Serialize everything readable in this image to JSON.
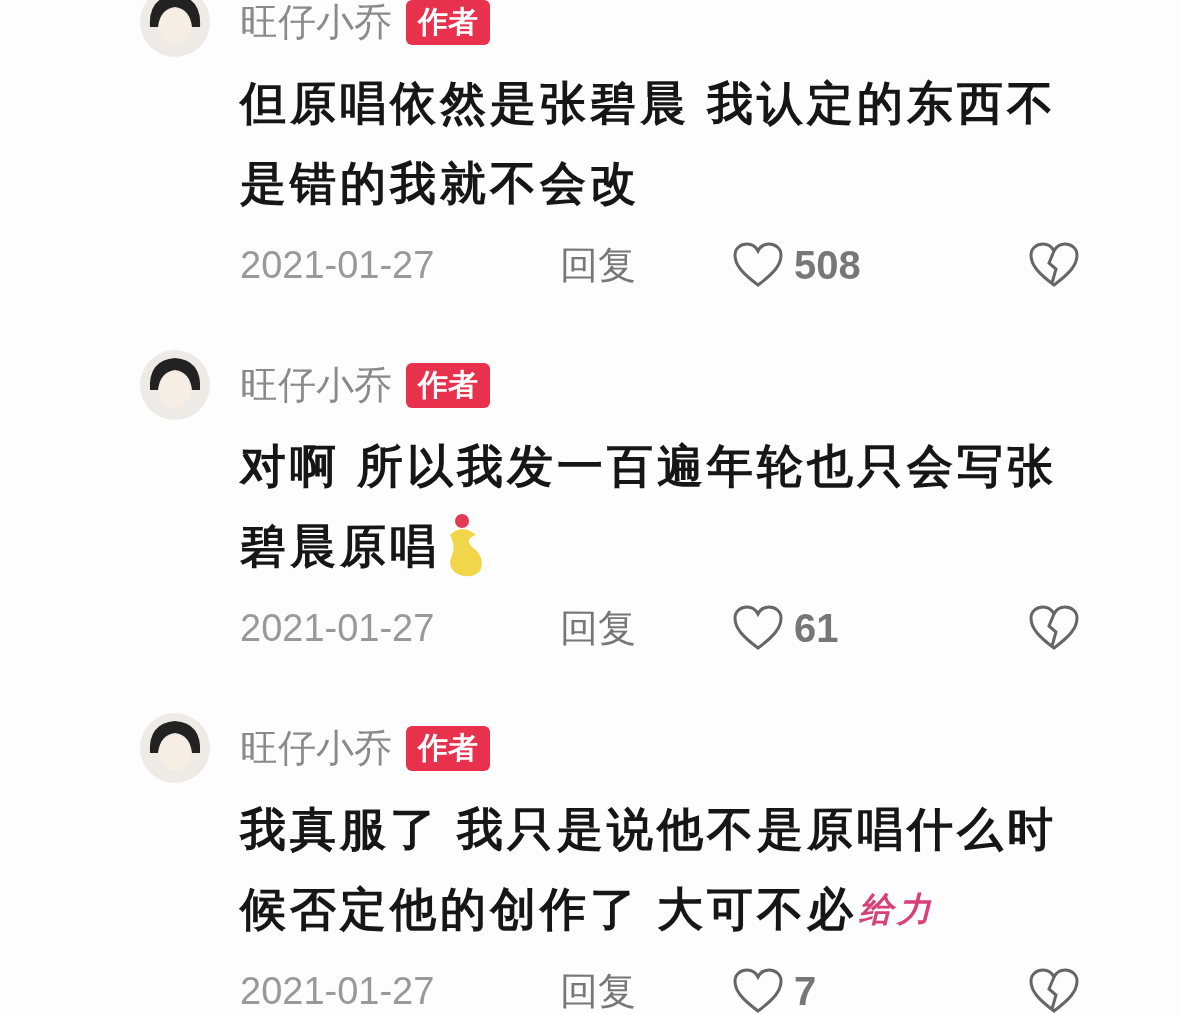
{
  "comments": [
    {
      "author": "旺仔小乔",
      "badge": "作者",
      "lines": [
        "但原唱依然是张碧晨 我认定的东西不",
        "是错的我就不会改"
      ],
      "date": "2021-01-27",
      "reply": "回复",
      "likes": "508"
    },
    {
      "author": "旺仔小乔",
      "badge": "作者",
      "lines": [
        "对啊 所以我发一百遍年轮也只会写张",
        "碧晨原唱"
      ],
      "sticker": {
        "kind": "heart-hands"
      },
      "date": "2021-01-27",
      "reply": "回复",
      "likes": "61"
    },
    {
      "author": "旺仔小乔",
      "badge": "作者",
      "lines": [
        "我真服了 我只是说他不是原唱什么时",
        "候否定他的创作了 大可不必"
      ],
      "sticker": {
        "kind": "text",
        "text": "给力"
      },
      "date": "2021-01-27",
      "reply": "回复",
      "likes": "7"
    }
  ]
}
